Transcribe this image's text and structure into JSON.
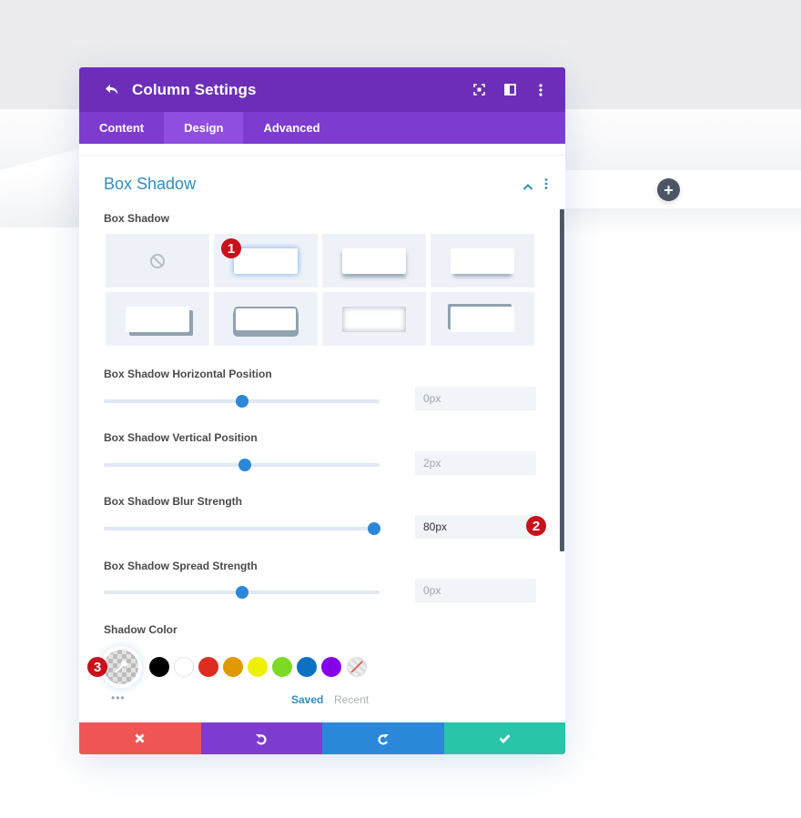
{
  "modal": {
    "title": "Column Settings",
    "tabs": [
      {
        "label": "Content",
        "active": false
      },
      {
        "label": "Design",
        "active": true
      },
      {
        "label": "Advanced",
        "active": false
      }
    ]
  },
  "section": {
    "title": "Box Shadow",
    "presets_label": "Box Shadow",
    "presets": [
      {
        "name": "none",
        "selected": false
      },
      {
        "name": "glow",
        "selected": true
      },
      {
        "name": "bottom-soft",
        "selected": false
      },
      {
        "name": "bottom-tight",
        "selected": false
      },
      {
        "name": "offset-right-bottom",
        "selected": false
      },
      {
        "name": "border-bottom",
        "selected": false
      },
      {
        "name": "inset",
        "selected": false
      },
      {
        "name": "offset-top-left",
        "selected": false
      }
    ],
    "sliders": [
      {
        "label": "Box Shadow Horizontal Position",
        "value": "0px",
        "fraction": 0.5,
        "active": false
      },
      {
        "label": "Box Shadow Vertical Position",
        "value": "2px",
        "fraction": 0.51,
        "active": false
      },
      {
        "label": "Box Shadow Blur Strength",
        "value": "80px",
        "fraction": 0.98,
        "active": true
      },
      {
        "label": "Box Shadow Spread Strength",
        "value": "0px",
        "fraction": 0.5,
        "active": false
      }
    ],
    "color_label": "Shadow Color",
    "swatches": [
      "#000000",
      "#ffffff",
      "#e02b20",
      "#e09900",
      "#edf000",
      "#7cda24",
      "#0c71c3",
      "#8300e9"
    ],
    "library_tabs": {
      "saved": "Saved",
      "recent": "Recent"
    },
    "more_label": "•••"
  },
  "annotations": [
    "1",
    "2",
    "3"
  ],
  "colors": {
    "header": "#6c2eb9",
    "tabs": "#7e3bd0",
    "accent": "#2b87da",
    "cancel": "#ef5555",
    "undo": "#7e3bd0",
    "redo": "#2b87da",
    "save": "#29c4a9"
  }
}
